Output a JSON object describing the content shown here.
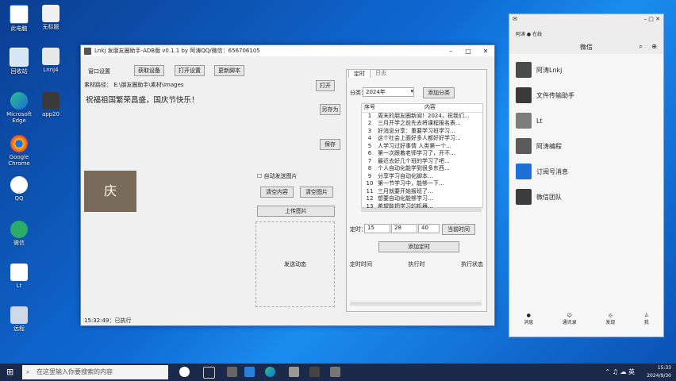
{
  "desktop": {
    "icons": [
      {
        "label": "此电脑"
      },
      {
        "label": "无标题"
      },
      {
        "label": "回收站"
      },
      {
        "label": "Lnnj4"
      },
      {
        "label": "Microsoft Edge"
      },
      {
        "label": "app20"
      },
      {
        "label": "Google Chrome"
      },
      {
        "label": "QQ"
      },
      {
        "label": "微信"
      },
      {
        "label": "Lt"
      },
      {
        "label": "远程"
      }
    ]
  },
  "app": {
    "title": "Lnkj 发朋友圈助手-ADB版 v0.1.1 by 阿涛QQ/微信：656706105",
    "toolbar": [
      "窗口设置",
      "获取设备",
      "打开设置",
      "更新脚本"
    ],
    "material_path_label": "素材路径：",
    "material_path_value": "E:\\朋友圈助手\\素材\\images",
    "open_button": "打开",
    "post_text": "祝福祖国繁荣昌盛，国庆节快乐！",
    "save_as_button": "另存为",
    "save_button": "保存",
    "clear_content_button": "清空内容",
    "clear_images_button": "清空图片",
    "upload_images_button": "上传图片",
    "checkbox_label": "自动发送图片",
    "send_button": "发送动态",
    "status": "15:32:49：已执行",
    "tabs": [
      "定时",
      "日志"
    ],
    "category_label": "分类：",
    "category_value": "2024年",
    "add_category_button": "添加分类",
    "table_headers": [
      "序号",
      "内容"
    ],
    "table_rows": [
      {
        "n": "1",
        "t": "周末的朋友圈新闻！2024，祝我们..."
      },
      {
        "n": "2",
        "t": "三月开学之前先去将课程报名表..."
      },
      {
        "n": "3",
        "t": "好消息分享：重要学习班学习..."
      },
      {
        "n": "4",
        "t": "这个社会上面好多人都好好学习..."
      },
      {
        "n": "5",
        "t": "人学习过好事情 人类第一个..."
      },
      {
        "n": "6",
        "t": "第一次跟着老师学习了，开不..."
      },
      {
        "n": "7",
        "t": "最近去好几个班的学习了吧..."
      },
      {
        "n": "8",
        "t": "个人自动化能学到很多东西..."
      },
      {
        "n": "9",
        "t": "分享学习自动化脚本..."
      },
      {
        "n": "10",
        "t": "第一节学习中，能够一下..."
      },
      {
        "n": "11",
        "t": "三月就要开始报班了..."
      },
      {
        "n": "12",
        "t": "想要自动化能够学习..."
      },
      {
        "n": "13",
        "t": "希望能把学习的机器..."
      }
    ],
    "timer_label": "定时：",
    "timer_h": "15",
    "timer_m": "28",
    "timer_s": "40",
    "current_time_button": "当前时间",
    "add_timer_button": "添加定时",
    "schedule_headers": [
      "定时时间",
      "执行时",
      "执行状态"
    ]
  },
  "wechat": {
    "title": "微信",
    "status": "阿涛 ● 在线",
    "chats": [
      {
        "name": "阿涛Lnkj",
        "color": "#4a4a4a"
      },
      {
        "name": "文件传输助手",
        "color": "#3a3a3a"
      },
      {
        "name": "Lt",
        "color": "#7d7d7d"
      },
      {
        "name": "阿涛编程",
        "color": "#5b5b5b"
      },
      {
        "name": "订阅号消息",
        "color": "#1f6fd6"
      },
      {
        "name": "微信团队",
        "color": "#3c3c3c"
      }
    ],
    "nav": [
      "消息",
      "通讯录",
      "发现",
      "我"
    ]
  },
  "taskbar": {
    "search_placeholder": "在这里输入你要搜索的内容",
    "time": "15:33",
    "date": "2024/9/30"
  }
}
